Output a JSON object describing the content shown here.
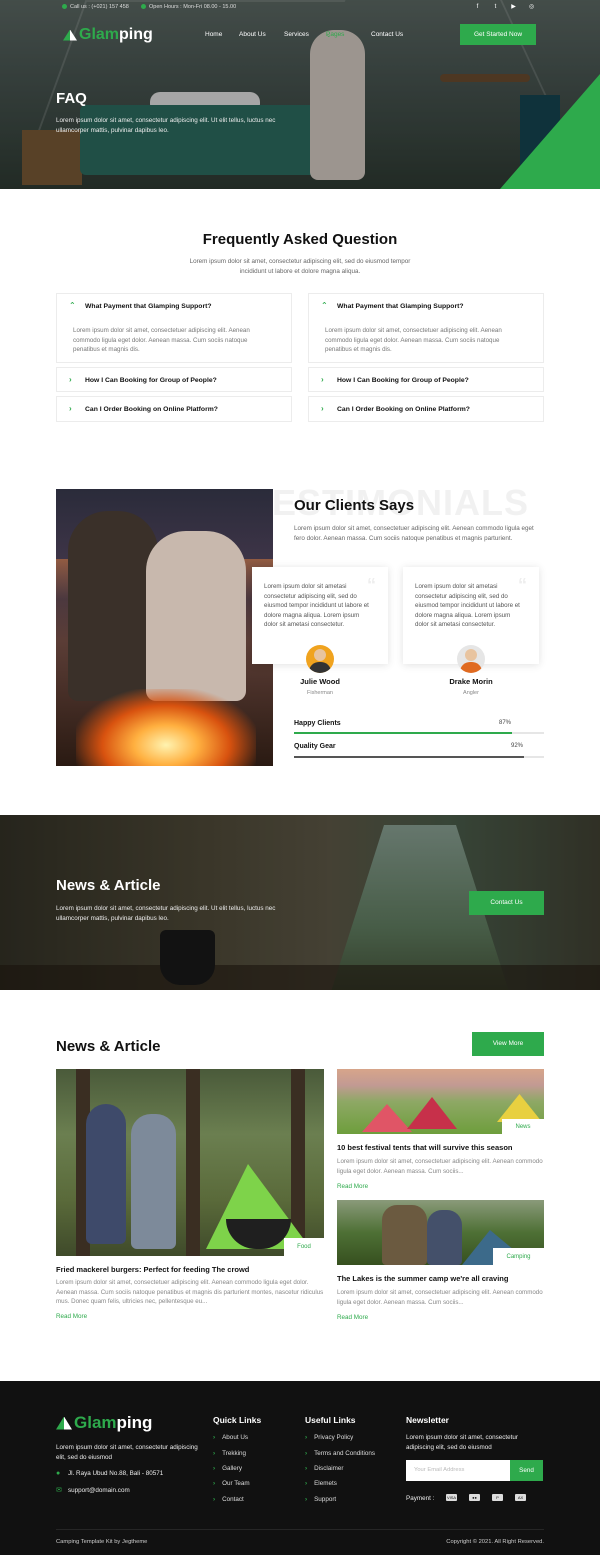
{
  "topbar": {
    "call": "Call us : (+021) 157 458",
    "hours": "Open Hours : Mon-Fri 08.00 - 15.00"
  },
  "social": [
    "facebook-icon",
    "twitter-icon",
    "youtube-icon",
    "instagram-icon"
  ],
  "brand": {
    "part1": "Glam",
    "part2": "ping"
  },
  "nav": {
    "items": [
      "Home",
      "About Us",
      "Services",
      "Pages",
      "Contact Us"
    ],
    "active": "Pages"
  },
  "header": {
    "cta": "Get Started Now"
  },
  "hero": {
    "title": "FAQ",
    "desc": "Lorem ipsum dolor sit amet, consectetur adipiscing elit. Ut elit tellus, luctus nec ullamcorper mattis, pulvinar dapibus leo."
  },
  "faq": {
    "title": "Frequently Asked Question",
    "subtitle": "Lorem ipsum dolor sit amet, consectetur adipiscing elit, sed do eiusmod tempor incididunt ut labore et dolore magna aliqua.",
    "columns": [
      {
        "open": {
          "q": "What Payment that Glamping Support?",
          "a": "Lorem ipsum dolor sit amet, consectetuer adipiscing elit. Aenean commodo ligula eget dolor. Aenean massa. Cum sociis natoque penatibus et magnis dis."
        },
        "items": [
          "How I Can Booking for Group of People?",
          "Can I Order Booking on Online Platform?"
        ]
      },
      {
        "open": {
          "q": "What Payment that Glamping Support?",
          "a": "Lorem ipsum dolor sit amet, consectetuer adipiscing elit. Aenean commodo ligula eget dolor. Aenean massa. Cum sociis natoque penatibus et magnis dis."
        },
        "items": [
          "How I Can Booking for Group of People?",
          "Can I Order Booking on Online Platform?"
        ]
      }
    ]
  },
  "testimonials": {
    "ghost": "ESTIMONIALS",
    "title": "Our Clients Says",
    "desc": "Lorem ipsum dolor sit amet, consectetuer adipiscing elit. Aenean commodo ligula eget  fero dolor. Aenean massa. Cum sociis natoque penatibus et magnis parturient.",
    "cards": [
      {
        "text": "Lorem ipsum dolor sit ametasi consectetur adipiscing elit, sed do eiusmod tempor incididunt ut labore et dolore magna aliqua. Lorem ipsum dolor sit ametasi consectetur.",
        "name": "Julie Wood",
        "role": "Fisherman"
      },
      {
        "text": "Lorem ipsum dolor sit ametasi consectetur adipiscing elit, sed do eiusmod tempor incididunt ut labore et dolore magna aliqua. Lorem ipsum dolor sit ametasi consectetur.",
        "name": "Drake Morin",
        "role": "Angler"
      }
    ],
    "bars": [
      {
        "label": "Happy Clients",
        "pct": "87%",
        "value": 0.87,
        "color": "#2eaa4c"
      },
      {
        "label": "Quality Gear",
        "pct": "92%",
        "value": 0.92,
        "color": "#555555"
      }
    ]
  },
  "banner": {
    "title": "News & Article",
    "desc": "Lorem ipsum dolor sit amet, consectetur adipiscing elit. Ut elit tellus, luctus nec ullamcorper mattis, pulvinar dapibus leo.",
    "cta": "Contact Us"
  },
  "news": {
    "title": "News & Article",
    "view_more": "View More",
    "read_more": "Read More",
    "articles": [
      {
        "tag": "Food",
        "title": "Fried mackerel burgers: Perfect for feeding The crowd",
        "text": "Lorem ipsum dolor sit amet, consectetuer adipiscing elit. Aenean commodo ligula eget dolor. Aenean massa. Cum sociis natoque penatibus et magnis dis parturient montes, nascetur ridiculus mus. Donec quam felis, ultricies nec, pellentesque eu..."
      },
      {
        "tag": "News",
        "title": "10 best festival tents that will survive this season",
        "text": "Lorem ipsum dolor sit amet, consectetuer adipiscing elit. Aenean commodo ligula eget dolor. Aenean massa. Cum sociis..."
      },
      {
        "tag": "Camping",
        "title": "The Lakes is the summer camp we're all craving",
        "text": "Lorem ipsum dolor sit amet, consectetuer adipiscing elit. Aenean commodo ligula eget dolor. Aenean massa. Cum sociis..."
      }
    ]
  },
  "footer": {
    "desc": "Lorem ipsum dolor sit amet, consectetur adipiscing elit, sed do eiusmod",
    "address": "Jl. Raya Ubud No.88, Bali - 80571",
    "email": "support@domain.com",
    "quick_title": "Quick Links",
    "quick_links": [
      "About Us",
      "Trekking",
      "Gallery",
      "Our Team",
      "Contact"
    ],
    "useful_title": "Useful Links",
    "useful_links": [
      "Privacy Policy",
      "Terms and Conditions",
      "Disclaimer",
      "Elemets",
      "Support"
    ],
    "newsletter_title": "Newsletter",
    "newsletter_desc": "Lorem ipsum dolor sit amet, consectetur adipiscing elit, sed do eiusmod",
    "email_placeholder": "Your Email Address",
    "send": "Send",
    "payment_label": "Payment :",
    "payments": [
      "visa-icon",
      "mastercard-icon",
      "paypal-icon",
      "amex-icon"
    ],
    "left_copy": "Camping Template Kit by Jegtheme",
    "right_copy": "Copyright © 2021. All Right Reserved."
  }
}
